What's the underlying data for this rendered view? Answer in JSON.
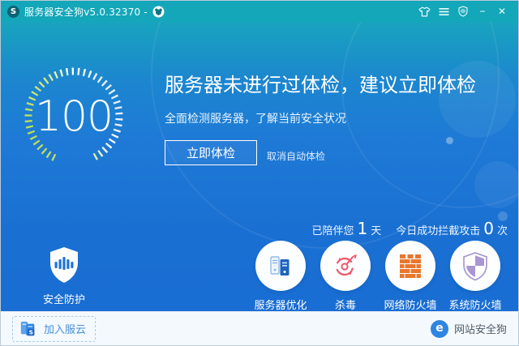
{
  "titlebar": {
    "title": "服务器安全狗v5.0.32370 -",
    "logo_letter": "S",
    "minimize_glyph": "–",
    "close_glyph": "✕"
  },
  "hero": {
    "score": "100",
    "heading": "服务器未进行过体检，建议立即体检",
    "subheading": "全面检测服务器，了解当前安全状况",
    "primary_button": "立即体检",
    "cancel_link": "取消自动体检"
  },
  "stats": {
    "accompany_prefix": "已陪伴您",
    "accompany_value": "1",
    "accompany_unit": "天",
    "blocked_prefix": "今日成功拦截攻击",
    "blocked_value": "0",
    "blocked_unit": "次"
  },
  "protection": {
    "label": "安全防护"
  },
  "features": [
    {
      "label": "服务器优化",
      "icon": "server-optimize-icon"
    },
    {
      "label": "杀毒",
      "icon": "antivirus-icon"
    },
    {
      "label": "网络防火墙",
      "icon": "network-firewall-icon"
    },
    {
      "label": "系统防火墙",
      "icon": "system-firewall-icon"
    }
  ],
  "footer": {
    "join_cloud": "加入服云",
    "join_badge_letter": "S",
    "website_dog": "网站安全狗",
    "website_dog_letter": "e"
  },
  "colors": {
    "titlebar_bg": "#14a6b9",
    "main_gradient_top": "#18a4be",
    "main_gradient_bottom": "#196dd3",
    "gauge_tick_green": "#b9dc52",
    "footer_bg": "#f4f9fd",
    "footer_link_blue": "#4a90da",
    "antivirus_red": "#f0566c",
    "firewall_orange": "#e8772e",
    "system_shield_purple": "#a996d2",
    "server_blue": "#1e63c0",
    "website_dog_blue": "#2f86e0"
  }
}
